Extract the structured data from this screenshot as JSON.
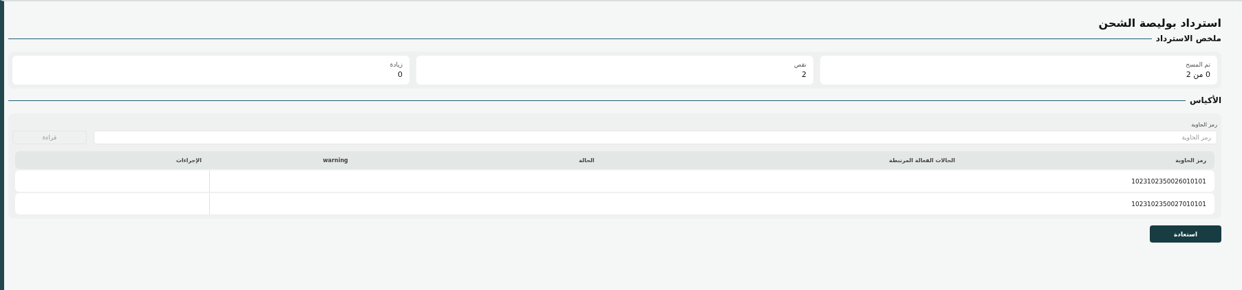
{
  "page": {
    "title": "استرداد بوليصة الشحن"
  },
  "summary": {
    "heading": "ملخص الاسترداد",
    "cards": [
      {
        "label": "تم المسح",
        "value": "0 من 2"
      },
      {
        "label": "نقص",
        "value": "2"
      },
      {
        "label": "زيادة",
        "value": "0"
      }
    ]
  },
  "bags": {
    "heading": "الأكياس",
    "field": {
      "label": "رمز الحاوية",
      "placeholder": "رمز الحاوية"
    },
    "read_button": {
      "label": "قراءة",
      "disabled": true
    },
    "table": {
      "columns": [
        "رمز الحاوية",
        "الحالات الفعالة المرتبطة",
        "الحالة",
        "warning",
        "الإجراءات"
      ],
      "rows": [
        {
          "container_code": "1023102350026010101"
        },
        {
          "container_code": "1023102350027010101"
        }
      ]
    }
  },
  "restore_button": {
    "label": "استعادة"
  }
}
